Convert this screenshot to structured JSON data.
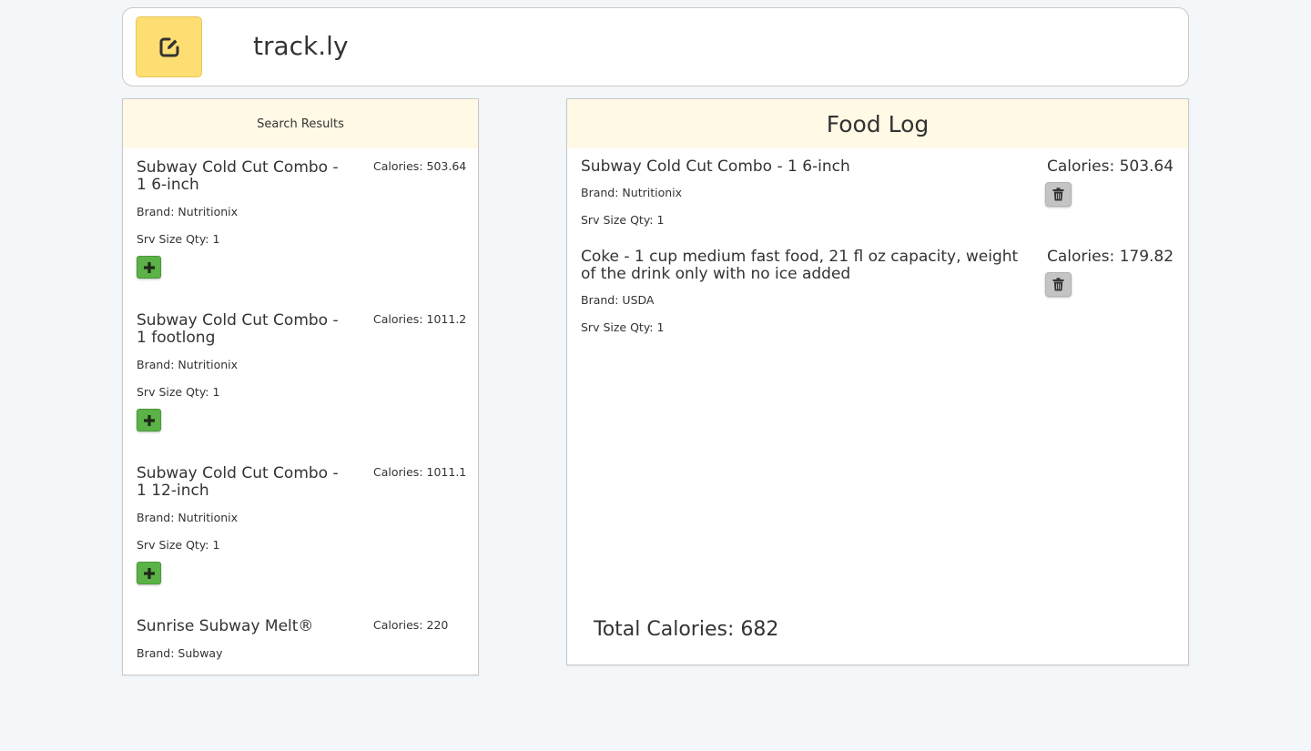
{
  "header": {
    "title": "track.ly",
    "logo_icon": "edit-square-icon",
    "logo_color": "#fedd72"
  },
  "search_results": {
    "title": "Search Results",
    "add_icon": "plus-icon",
    "add_color": "#5bb246",
    "items": [
      {
        "name": "Subway Cold Cut Combo - 1 6-inch",
        "calories": "Calories: 503.64",
        "brand": "Brand: Nutritionix",
        "srv": "Srv Size Qty: 1"
      },
      {
        "name": "Subway Cold Cut Combo - 1 footlong",
        "calories": "Calories: 1011.2",
        "brand": "Brand: Nutritionix",
        "srv": "Srv Size Qty: 1"
      },
      {
        "name": "Subway Cold Cut Combo - 1 12-inch",
        "calories": "Calories: 1011.1",
        "brand": "Brand: Nutritionix",
        "srv": "Srv Size Qty: 1"
      },
      {
        "name": "Sunrise Subway Melt®",
        "calories": "Calories: 220",
        "brand": "Brand: Subway"
      }
    ]
  },
  "food_log": {
    "title": "Food Log",
    "delete_icon": "trash-icon",
    "items": [
      {
        "name": "Subway Cold Cut Combo - 1 6-inch",
        "calories": "Calories: 503.64",
        "brand": "Brand: Nutritionix",
        "srv": "Srv Size Qty: 1"
      },
      {
        "name": "Coke - 1 cup medium fast food, 21 fl oz capacity, weight of the drink only with no ice added",
        "calories": "Calories: 179.82",
        "brand": "Brand: USDA",
        "srv": "Srv Size Qty: 1"
      }
    ],
    "total": "Total Calories: 682"
  }
}
